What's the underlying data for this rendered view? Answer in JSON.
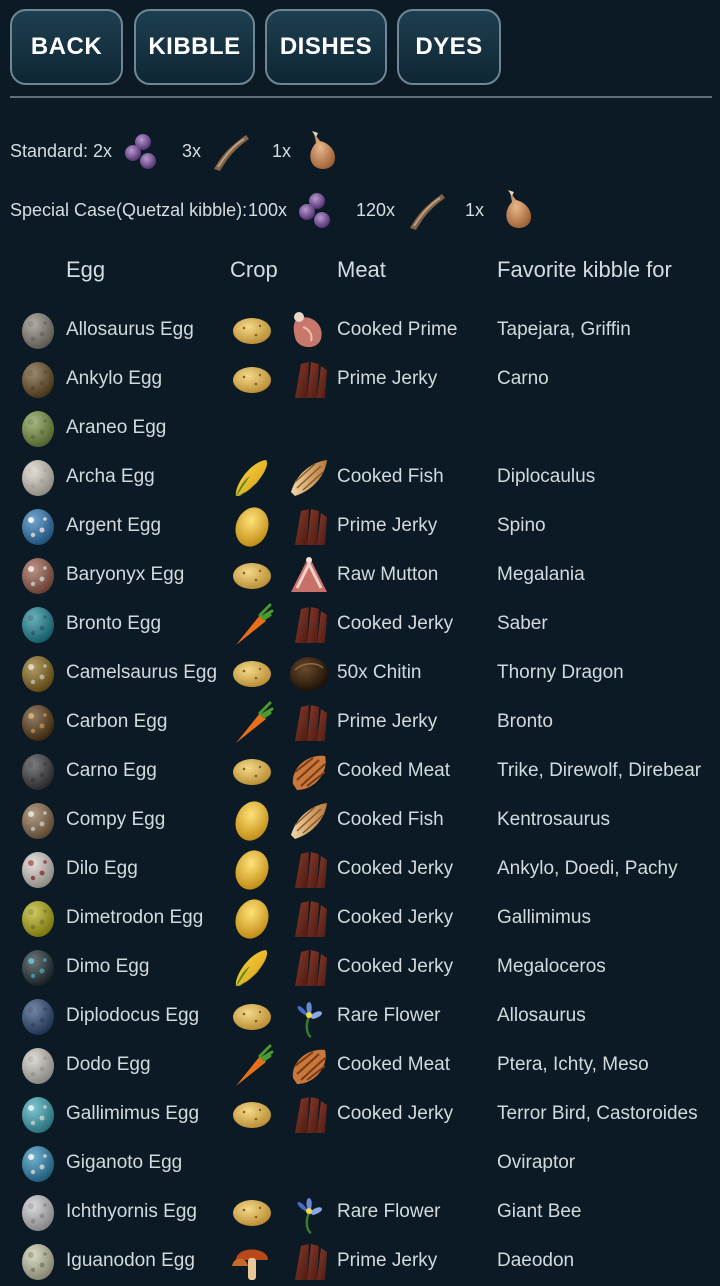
{
  "nav": {
    "back": "BACK",
    "kibble": "KIBBLE",
    "dishes": "DISHES",
    "dyes": "DYES"
  },
  "standard": {
    "label": "Standard:",
    "berries_qty": "2x",
    "fiber_qty": "3x",
    "meat_qty": "1x"
  },
  "special": {
    "label": "Special Case(Quetzal kibble):",
    "berries_qty": "100x",
    "fiber_qty": "120x",
    "meat_qty": "1x"
  },
  "table": {
    "headers": {
      "egg": "Egg",
      "crop": "Crop",
      "meat": "Meat",
      "fav": "Favorite kibble for"
    },
    "rows": [
      {
        "egg": "Allosaurus Egg",
        "egg_color": "#8a8478",
        "spot_color": "#6b665d",
        "crop_icon": "potato-icon",
        "meat_icon": "prime-meat-icon",
        "meat": "Cooked Prime",
        "fav": "Tapejara, Griffin"
      },
      {
        "egg": "Ankylo Egg",
        "egg_color": "#6b4e22",
        "spot_color": "#4e3815",
        "crop_icon": "potato-icon",
        "meat_icon": "jerky-icon",
        "meat": "Prime Jerky",
        "fav": "Carno"
      },
      {
        "egg": "Araneo Egg",
        "egg_color": "#7a9640",
        "spot_color": "#5b7430",
        "crop_icon": "",
        "meat_icon": "",
        "meat": "",
        "fav": ""
      },
      {
        "egg": "Archa Egg",
        "egg_color": "#d8d2c4",
        "spot_color": "#c9bfa8",
        "crop_icon": "corn-icon",
        "meat_icon": "fish-icon",
        "meat": "Cooked Fish",
        "fav": "Diplocaulus"
      },
      {
        "egg": "Argent Egg",
        "egg_color": "#2a78b8",
        "spot_color": "#ffffff",
        "crop_icon": "lemon-icon",
        "meat_icon": "jerky-icon",
        "meat": "Prime Jerky",
        "fav": "Spino"
      },
      {
        "egg": "Baryonyx Egg",
        "egg_color": "#9a5a48",
        "spot_color": "#e8e0d8",
        "crop_icon": "potato-icon",
        "meat_icon": "mutton-icon",
        "meat": "Raw Mutton",
        "fav": "Megalania"
      },
      {
        "egg": "Bronto Egg",
        "egg_color": "#1a8a9a",
        "spot_color": "#0d5a66",
        "crop_icon": "carrot-icon",
        "meat_icon": "jerky-icon",
        "meat": "Cooked Jerky",
        "fav": "Saber"
      },
      {
        "egg": "Camelsaurus Egg",
        "egg_color": "#8a6a18",
        "spot_color": "#d8d0b0",
        "crop_icon": "potato-icon",
        "meat_icon": "chitin-icon",
        "meat": "50x Chitin",
        "fav": "Thorny Dragon"
      },
      {
        "egg": "Carbon Egg",
        "egg_color": "#5a3a14",
        "spot_color": "#c88a30",
        "crop_icon": "carrot-icon",
        "meat_icon": "jerky-icon",
        "meat": "Prime Jerky",
        "fav": "Bronto"
      },
      {
        "egg": "Carno Egg",
        "egg_color": "#3a3a3e",
        "spot_color": "#222226",
        "crop_icon": "potato-icon",
        "meat_icon": "cooked-meat-icon",
        "meat": "Cooked Meat",
        "fav": "Trike, Direwolf, Direbear"
      },
      {
        "egg": "Compy Egg",
        "egg_color": "#8a6a48",
        "spot_color": "#e0d8c8",
        "crop_icon": "lemon-icon",
        "meat_icon": "fish-icon",
        "meat": "Cooked Fish",
        "fav": "Kentrosaurus"
      },
      {
        "egg": "Dilo Egg",
        "egg_color": "#d8d0c8",
        "spot_color": "#9a3030",
        "crop_icon": "lemon-icon",
        "meat_icon": "jerky-icon",
        "meat": "Cooked Jerky",
        "fav": "Ankylo, Doedi, Pachy"
      },
      {
        "egg": "Dimetrodon Egg",
        "egg_color": "#b8b010",
        "spot_color": "#8a8208",
        "crop_icon": "lemon-icon",
        "meat_icon": "jerky-icon",
        "meat": "Cooked Jerky",
        "fav": "Gallimimus"
      },
      {
        "egg": "Dimo Egg",
        "egg_color": "#1e2e34",
        "spot_color": "#2aa0b8",
        "crop_icon": "corn-icon",
        "meat_icon": "jerky-icon",
        "meat": "Cooked Jerky",
        "fav": "Megaloceros"
      },
      {
        "egg": "Diplodocus Egg",
        "egg_color": "#2a4a7a",
        "spot_color": "#1a2e50",
        "crop_icon": "potato-icon",
        "meat_icon": "flower-icon",
        "meat": "Rare Flower",
        "fav": "Allosaurus"
      },
      {
        "egg": "Dodo Egg",
        "egg_color": "#cfcac2",
        "spot_color": "#b0aaa0",
        "crop_icon": "carrot-icon",
        "meat_icon": "cooked-meat-icon",
        "meat": "Cooked Meat",
        "fav": "Ptera, Ichty, Meso"
      },
      {
        "egg": "Gallimimus Egg",
        "egg_color": "#3aa8b8",
        "spot_color": "#d8f0f0",
        "crop_icon": "potato-icon",
        "meat_icon": "jerky-icon",
        "meat": "Cooked Jerky",
        "fav": "Terror Bird, Castoroides"
      },
      {
        "egg": "Giganoto Egg",
        "egg_color": "#2a8ab8",
        "spot_color": "#e8f0f8",
        "crop_icon": "",
        "meat_icon": "",
        "meat": "",
        "fav": "Oviraptor"
      },
      {
        "egg": "Ichthyornis Egg",
        "egg_color": "#c8c8cc",
        "spot_color": "#9a9aa0",
        "crop_icon": "potato-icon",
        "meat_icon": "flower-icon",
        "meat": "Rare Flower",
        "fav": "Giant Bee"
      },
      {
        "egg": "Iguanodon Egg",
        "egg_color": "#c8c8a8",
        "spot_color": "#8a8a6a",
        "crop_icon": "mushroom-icon",
        "meat_icon": "jerky-icon",
        "meat": "Prime Jerky",
        "fav": "Daeodon"
      }
    ]
  }
}
